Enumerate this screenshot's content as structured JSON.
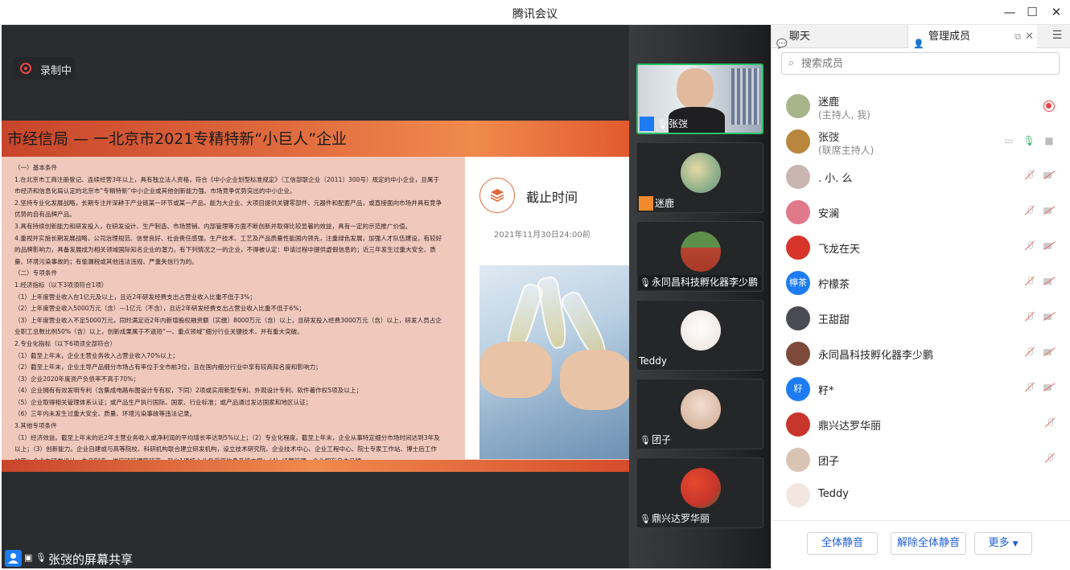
{
  "window": {
    "title": "腾讯会议"
  },
  "stage": {
    "recording_label": "录制中",
    "share_label": "张弢的屏幕共享",
    "slide": {
      "header": "市经信局 — 一北京市2021专精特新“小巨人”企业",
      "deadline_title": "截止时间",
      "deadline_date": "2021年11月30日24:00前",
      "body_lines": [
        "（一）基本条件",
        "1.在北京市工商注册登记、连续经营3年以上，具有独立法人资格，符合《中小企业划型标准规定》（工信部联企业〔2011〕300号）规定的中小企业，且属于",
        "市经济和信息化局认定的北京市“专精特新”中小企业或其他创新能力强、市场竞争优势突出的中小企业。",
        "2.坚持专业化发展战略，长期专注并深耕于产业链某一环节或某一产品，能为大企业、大项目提供关键零部件、元器件和配套产品，或直接面向市场并具有竞争",
        "优势的自有品牌产品。",
        "3.具有持续创新能力和研发投入，在研发设计、生产制造、市场营销、内部管理等方面不断创新并取得比较显著的效益，具有一定的示范推广价值。",
        "4.重视并实施长期发展战略，公司治理规范、信誉良好、社会责任感强，生产技术、工艺及产品质量性能国内领先，注重绿色发展，加强人才队伍建设，有较好",
        "的品牌影响力，具备发展成为相关领域国际知名企业的潜力。有下列情况之一的企业，不得被认定：申请过程中提供虚假信息的；近三年发生过重大安全、质",
        "量、环境污染事故的；有偷漏税或其他违法违规、严重失信行为的。",
        "（二）专项条件",
        "1.经济指标（以下3项须符合1项）",
        "（1）上年度营业收入在1亿元及以上，且近2年研发经费支出占营业收入比重不低于3%；",
        "（2）上年度营业收入5000万元（含）—1亿元（不含），且近2年研发经费支出占营业收入比重不低于6%；",
        "（3）上年度营业收入不足5000万元，同时满足近2年内新增股权融资额（实缴）8000万元（含）以上，且研发投入经费3000万元（含）以上，研发人员占企",
        "业职工总数比例50%（含）以上，创新成果属于不遗短“一、重点领域”细分行业关键技术，并有重大突破。",
        "2.专业化指标（以下6项须全部符合）",
        "（1）截至上年末，企业主营业务收入占营业收入70%以上；",
        "（2）截至上年末，企业主导产品细分市场占有率位于全市前3位，且在国内细分行业中享有较高知名度和影响力；",
        "（3）企业2020年度资产负债率不高于70%；",
        "（4）企业拥有有效发明专利（含集成电路布图设计专有权，下同）2项或实用新型专利、外观设计专利、软件著作权5项及以上；",
        "（5）企业取得相关管理体系认证；或产品生产执行国际、国家、行业标准；或产品通过发达国家和地区认证；",
        "（6）三年内未发生过重大安全、质量、环境污染事故等违法记录。",
        "3.其他专项条件",
        "（1）经济效益。截至上年末的近2年主营业务收入或净利润的平均增长率达到5%以上；（2）专业化程度。截至上年末，企业从事特定细分市场时间达到3年及",
        "以上；（3）创新能力。企业自建或与高等院校、科研机构联合建立研发机构，设立技术研究院、企业技术中心、企业工程中心、院士专家工作站、博士后工作",
        "站等；企业在研发设计、生产制造、供应链管理等环节，至少1项核心业务采用信息系统支撑；（4）经营管理。企业拥有自主品牌。"
      ]
    }
  },
  "gallery": {
    "tiles": [
      {
        "name": "张弢",
        "active": true
      },
      {
        "name": "迷鹿",
        "active": false
      },
      {
        "name": "永同昌科技孵化器李少鹏",
        "active": false
      },
      {
        "name": "Teddy",
        "active": false
      },
      {
        "name": "团子",
        "active": false
      },
      {
        "name": "鼎兴达罗华丽",
        "active": false
      }
    ]
  },
  "panel": {
    "tab_chat": "聊天",
    "tab_members": "管理成员",
    "search_placeholder": "搜索成员",
    "members": [
      {
        "name": "迷鹿",
        "role": "(主持人, 我)",
        "avatar_text": "",
        "avatar_color": "#a8b58a",
        "status": "recording"
      },
      {
        "name": "张弢",
        "role": "(联席主持人)",
        "avatar_text": "",
        "avatar_color": "#b8863c",
        "status": "active"
      },
      {
        "name": ". 小. 么",
        "role": "",
        "avatar_text": "",
        "avatar_color": "#c9b6b0",
        "status": "muted"
      },
      {
        "name": "安澜",
        "role": "",
        "avatar_text": "",
        "avatar_color": "#e07a8a",
        "status": "muted"
      },
      {
        "name": "飞龙在天",
        "role": "",
        "avatar_text": "",
        "avatar_color": "#d8352a",
        "status": "muted"
      },
      {
        "name": "柠檬茶",
        "role": "",
        "avatar_text": "檸茶",
        "avatar_color": "#1e7cf2",
        "status": "muted"
      },
      {
        "name": "王甜甜",
        "role": "",
        "avatar_text": "",
        "avatar_color": "#4a4a52",
        "status": "muted"
      },
      {
        "name": "永同昌科技孵化器李少鹏",
        "role": "",
        "avatar_text": "",
        "avatar_color": "#7d4a3a",
        "status": "muted"
      },
      {
        "name": "籽*",
        "role": "",
        "avatar_text": "籽",
        "avatar_color": "#1e7cf2",
        "status": "muted"
      },
      {
        "name": "鼎兴达罗华丽",
        "role": "",
        "avatar_text": "",
        "avatar_color": "#c8352b",
        "status": "mic-only"
      },
      {
        "name": "团子",
        "role": "",
        "avatar_text": "",
        "avatar_color": "#d9c4b3",
        "status": "mic-only"
      },
      {
        "name": "Teddy",
        "role": "",
        "avatar_text": "",
        "avatar_color": "#f3e6e0",
        "status": "none"
      }
    ],
    "buttons": {
      "mute_all": "全体静音",
      "unmute_all": "解除全体静音",
      "more": "更多"
    }
  }
}
